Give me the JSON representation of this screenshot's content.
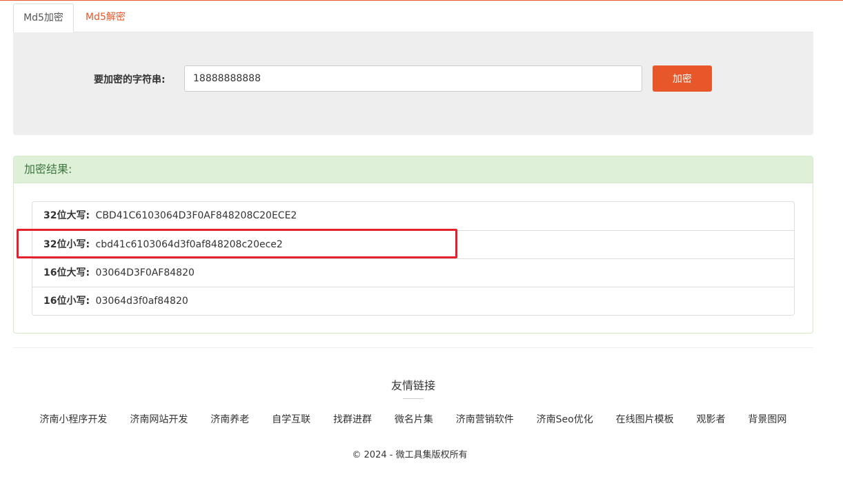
{
  "tabs": [
    {
      "label": "Md5加密",
      "active": true
    },
    {
      "label": "Md5解密",
      "active": false
    }
  ],
  "form": {
    "label": "要加密的字符串:",
    "input_value": "18888888888",
    "button_label": "加密"
  },
  "result": {
    "heading": "加密结果:",
    "rows": [
      {
        "key": "32位大写:",
        "value": "CBD41C6103064D3F0AF848208C20ECE2"
      },
      {
        "key": "32位小写:",
        "value": "cbd41c6103064d3f0af848208c20ece2"
      },
      {
        "key": "16位大写:",
        "value": "03064D3F0AF84820"
      },
      {
        "key": "16位小写:",
        "value": "03064d3f0af84820"
      }
    ]
  },
  "footer": {
    "links_title": "友情链接",
    "links": [
      "济南小程序开发",
      "济南网站开发",
      "济南养老",
      "自学互联",
      "找群进群",
      "微名片集",
      "济南营销软件",
      "济南Seo优化",
      "在线图片模板",
      "观影者",
      "背景图网"
    ],
    "copyright": "© 2024 - 微工具集版权所有"
  },
  "colors": {
    "accent": "#e8572a",
    "success_bg": "#dff0d8",
    "success_text": "#3c763d",
    "highlight": "#e5202e"
  }
}
